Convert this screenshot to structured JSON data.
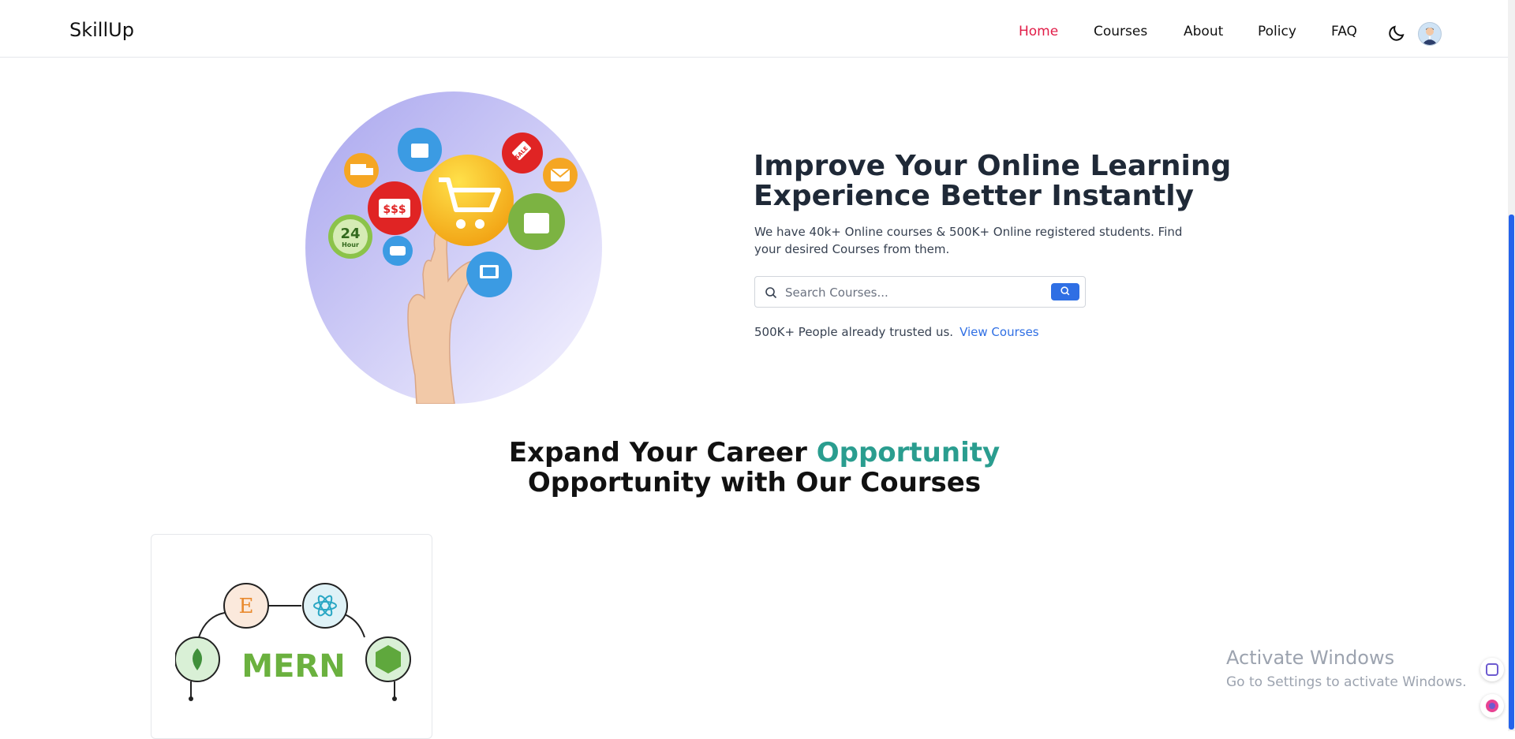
{
  "header": {
    "brand": "SkillUp",
    "nav": [
      "Home",
      "Courses",
      "About",
      "Policy",
      "FAQ"
    ],
    "active_nav": "Home",
    "theme_icon": "moon-icon",
    "avatar_icon": "user-avatar-icon"
  },
  "hero": {
    "title": "Improve Your Online Learning Experience Better Instantly",
    "description": "We have 40k+ Online courses & 500K+ Online registered students. Find your desired Courses from them.",
    "search_placeholder": "Search Courses...",
    "trust_text": "500K+ People already trusted us.",
    "trust_link": "View Courses",
    "illustration": {
      "badge_24": "24",
      "badge_hour": "Hour",
      "badge_money": "$$$",
      "badge_sale": "SALE"
    }
  },
  "section": {
    "title_prefix": "Expand Your Career",
    "title_highlight": "Opportunity",
    "title_suffix": "Opportunity with Our Courses"
  },
  "courses": [
    {
      "image_text": "MERN",
      "image_e": "E"
    }
  ],
  "watermark": {
    "title": "Activate Windows",
    "subtitle": "Go to Settings to activate Windows."
  },
  "colors": {
    "accent": "#2f6fe4",
    "active_nav": "#e11d48",
    "highlight": "#2a9d8f"
  }
}
